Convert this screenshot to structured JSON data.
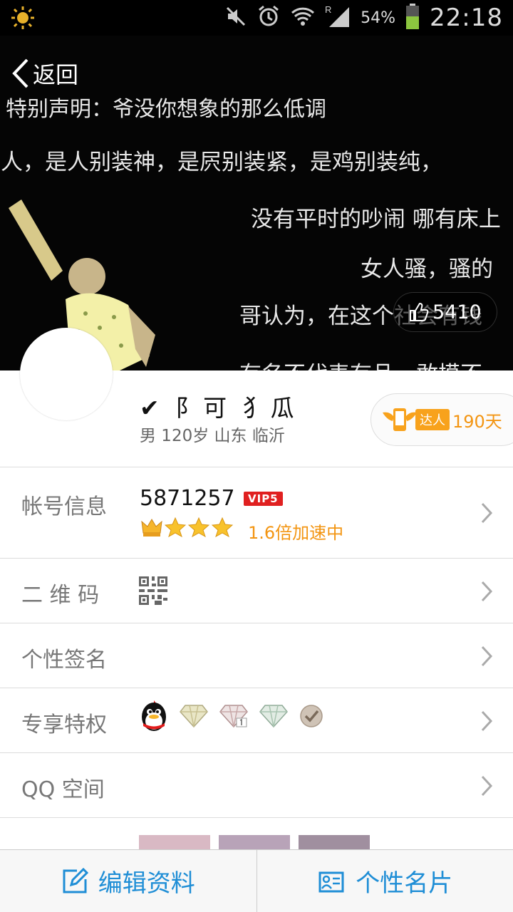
{
  "status": {
    "battery_pct": "54%",
    "clock": "22:18",
    "icons": [
      "sun-icon",
      "mute-icon",
      "alarm-icon",
      "wifi-icon",
      "signal-icon",
      "battery-icon"
    ],
    "roaming": "R"
  },
  "cover": {
    "lines": [
      "特别声明：爷没你想象的那么低调",
      "装人，是人别装神，是屄别装紧，是鸡别装纯，",
      "没有平时的吵闹 哪有床上",
      "女人骚，骚的",
      "哥认为，在这个社会有钱",
      "有名不代表有品，敢摸不"
    ],
    "back_label": "返回",
    "likes": "5410"
  },
  "profile": {
    "nickname": "✔ 阝可 犭瓜",
    "meta": "男 120岁 山东 临沂",
    "daren_tag": "达人",
    "daren_days": "190天"
  },
  "rows": {
    "account": {
      "label": "帐号信息",
      "number": "5871257",
      "vip": "VIP5",
      "speed": "1.6倍加速中"
    },
    "qr": {
      "label": "二 维 码"
    },
    "signature": {
      "label": "个性签名"
    },
    "privilege": {
      "label": "专享特权"
    },
    "qzone": {
      "label": "QQ 空间"
    }
  },
  "bottom": {
    "edit_label": "编辑资料",
    "card_label": "个性名片"
  },
  "colors": {
    "accent_blue": "#1f8ed6",
    "orange": "#f39512",
    "vip_red": "#e02020"
  }
}
